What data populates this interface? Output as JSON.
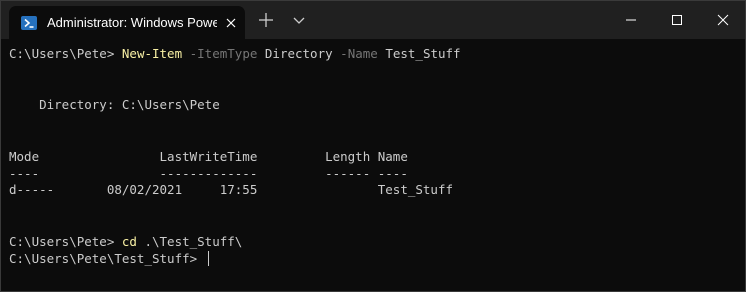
{
  "window": {
    "tab_title": "Administrator: Windows PowerShell",
    "tab_icon": "powershell-icon",
    "colors": {
      "titlebar": "#202020",
      "terminal_bg": "#0c0c0c",
      "text": "#cccccc",
      "command": "#f9f1a5",
      "parameter": "#767676",
      "ps_icon": "#2671be"
    }
  },
  "terminal": {
    "line1": {
      "prompt": "C:\\Users\\Pete> ",
      "cmdlet": "New-Item",
      "param1": " -ItemType",
      "arg1": " Directory",
      "param2": " -Name",
      "arg2": " Test_Stuff"
    },
    "directory_label": "    Directory: C:\\Users\\Pete",
    "headers": "Mode                LastWriteTime         Length Name",
    "underlines": "----                -------------         ------ ----",
    "row": "d-----       08/02/2021     17:55                Test_Stuff",
    "line2": {
      "prompt": "C:\\Users\\Pete> ",
      "cmdlet": "cd",
      "arg": " .\\Test_Stuff\\"
    },
    "current_prompt": "C:\\Users\\Pete\\Test_Stuff> "
  }
}
